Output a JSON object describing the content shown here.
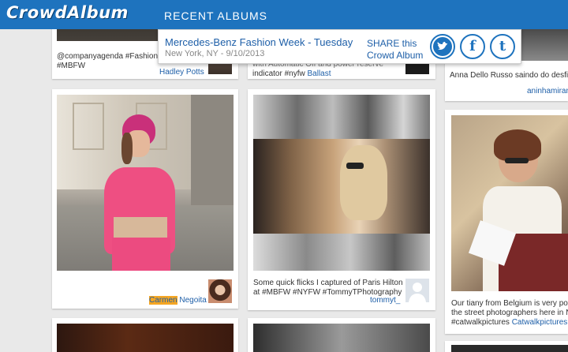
{
  "header": {
    "logo": "CrowdAlbum",
    "nav_title": "RECENT ALBUMS"
  },
  "album": {
    "title": "Mercedes-Benz Fashion Week - Tuesday",
    "subtitle": "New York, NY - 9/10/2013",
    "share_line1": "SHARE this",
    "share_line2": "Crowd Album",
    "share_icons": [
      "twitter-icon",
      "facebook-icon",
      "tumblr-icon"
    ]
  },
  "cards": {
    "top_left": {
      "caption": "@companyagenda #FashionS",
      "hashtag": "#MBFW",
      "author": "Hadley Potts"
    },
    "top_mid": {
      "caption_a": "with Automatic Off and power reserve",
      "caption_b": "indicator #nyfw",
      "author": "Ballast"
    },
    "top_right": {
      "caption": "Anna Dello Russo saindo do desfile",
      "author": "aninhamiran"
    },
    "pink": {
      "author_first": "Carmen",
      "author_last": " Negoita"
    },
    "paris": {
      "caption": "Some quick flicks I captured of Paris Hilton at #MBFW #NYFW #TommyTPhotography",
      "author": "tommyt_"
    },
    "belgium": {
      "caption_a": "Our tiany from Belgium is very pop",
      "caption_b": "the street photographers here in Ne",
      "caption_c": "#catwalkpictures",
      "author": "Catwalkpictures.c"
    }
  },
  "colors": {
    "brand": "#1e73be",
    "link": "#1e5fa8",
    "highlight": "#f5a623"
  }
}
